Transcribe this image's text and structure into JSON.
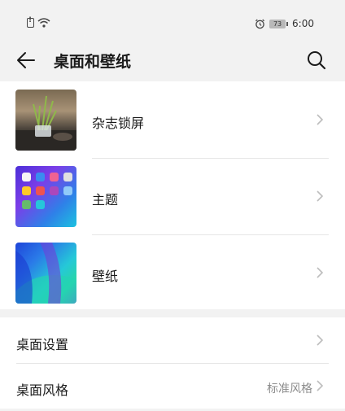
{
  "status_bar": {
    "time": "6:00",
    "battery": "73"
  },
  "header": {
    "title": "桌面和壁纸"
  },
  "main_list": [
    {
      "label": "杂志锁屏"
    },
    {
      "label": "主题"
    },
    {
      "label": "壁纸"
    }
  ],
  "settings_list": [
    {
      "label": "桌面设置",
      "value": ""
    },
    {
      "label": "桌面风格",
      "value": "标准风格"
    }
  ],
  "colors": {
    "background": "#f2f2f2",
    "card": "#ffffff",
    "secondary_text": "#8c8c8c"
  },
  "icons": [
    "sim-alert-icon",
    "wifi-icon",
    "alarm-icon",
    "battery-icon",
    "back-arrow-icon",
    "search-icon",
    "chevron-right-icon"
  ]
}
